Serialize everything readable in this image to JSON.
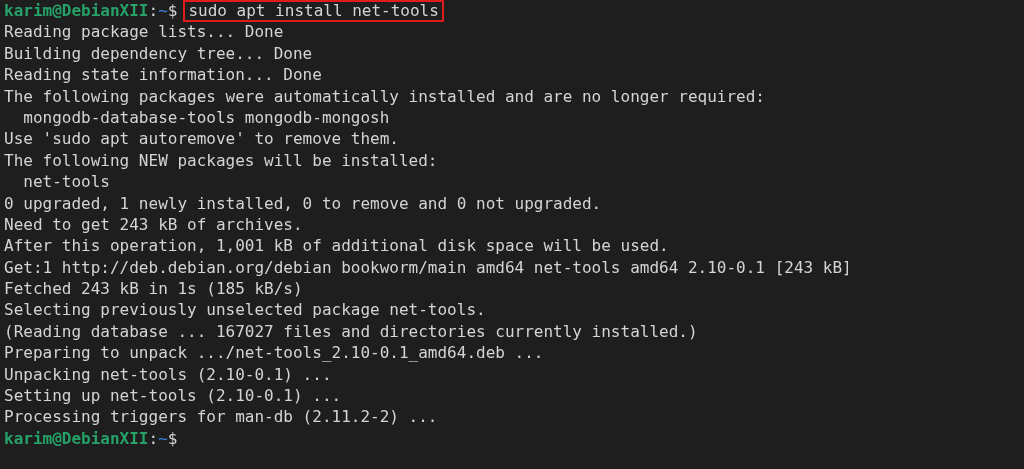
{
  "terminal": {
    "lines": [
      {
        "kind": "prompt",
        "user_host": "karim@DebianXII",
        "separator": ":",
        "path": "~",
        "symbol": "$",
        "command": "sudo apt install net-tools",
        "highlighted": true
      },
      {
        "kind": "output",
        "text": "Reading package lists... Done"
      },
      {
        "kind": "output",
        "text": "Building dependency tree... Done"
      },
      {
        "kind": "output",
        "text": "Reading state information... Done"
      },
      {
        "kind": "output",
        "text": "The following packages were automatically installed and are no longer required:"
      },
      {
        "kind": "output",
        "text": "  mongodb-database-tools mongodb-mongosh"
      },
      {
        "kind": "output",
        "text": "Use 'sudo apt autoremove' to remove them."
      },
      {
        "kind": "output",
        "text": "The following NEW packages will be installed:"
      },
      {
        "kind": "output",
        "text": "  net-tools"
      },
      {
        "kind": "output",
        "text": "0 upgraded, 1 newly installed, 0 to remove and 0 not upgraded."
      },
      {
        "kind": "output",
        "text": "Need to get 243 kB of archives."
      },
      {
        "kind": "output",
        "text": "After this operation, 1,001 kB of additional disk space will be used."
      },
      {
        "kind": "output",
        "text": "Get:1 http://deb.debian.org/debian bookworm/main amd64 net-tools amd64 2.10-0.1 [243 kB]"
      },
      {
        "kind": "output",
        "text": "Fetched 243 kB in 1s (185 kB/s)"
      },
      {
        "kind": "output",
        "text": "Selecting previously unselected package net-tools."
      },
      {
        "kind": "output",
        "text": "(Reading database ... 167027 files and directories currently installed.)"
      },
      {
        "kind": "output",
        "text": "Preparing to unpack .../net-tools_2.10-0.1_amd64.deb ..."
      },
      {
        "kind": "output",
        "text": "Unpacking net-tools (2.10-0.1) ..."
      },
      {
        "kind": "output",
        "text": "Setting up net-tools (2.10-0.1) ..."
      },
      {
        "kind": "output",
        "text": "Processing triggers for man-db (2.11.2-2) ..."
      },
      {
        "kind": "prompt",
        "user_host": "karim@DebianXII",
        "separator": ":",
        "path": "~",
        "symbol": "$"
      }
    ]
  }
}
